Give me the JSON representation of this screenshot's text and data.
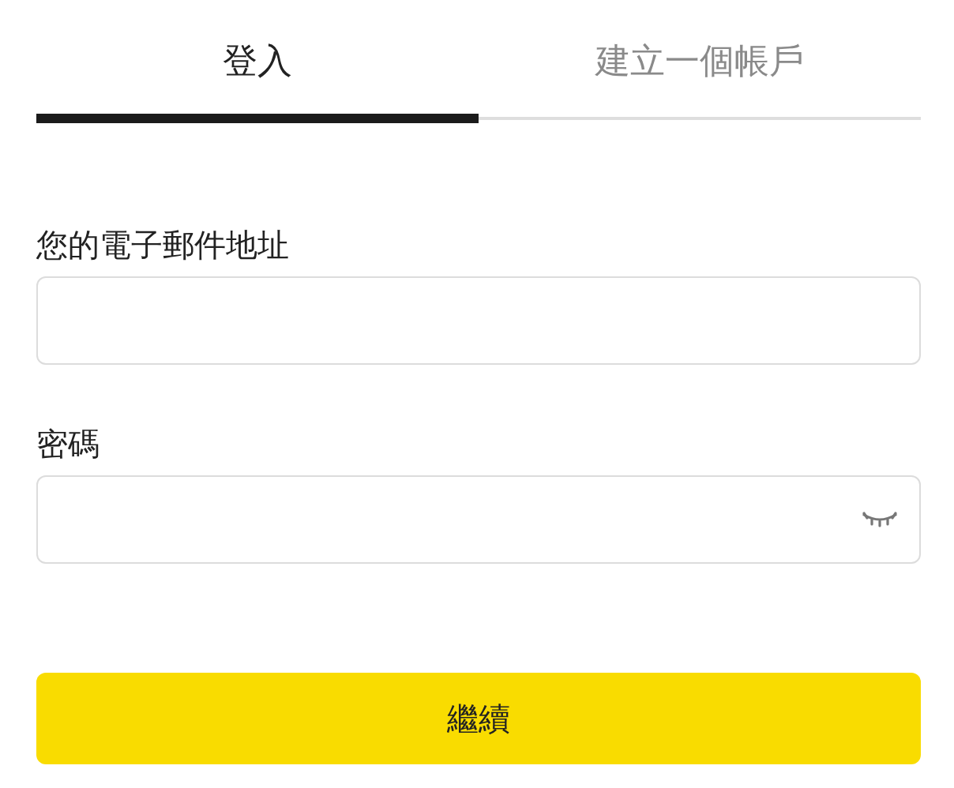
{
  "tabs": [
    {
      "label": "登入",
      "selected": true
    },
    {
      "label": "建立一個帳戶",
      "selected": false
    }
  ],
  "fields": [
    {
      "label": "您的電子郵件地址",
      "kind": "text"
    },
    {
      "label": "密碼",
      "kind": "password",
      "password_visible": false
    }
  ],
  "submit": {
    "label": "繼續"
  }
}
